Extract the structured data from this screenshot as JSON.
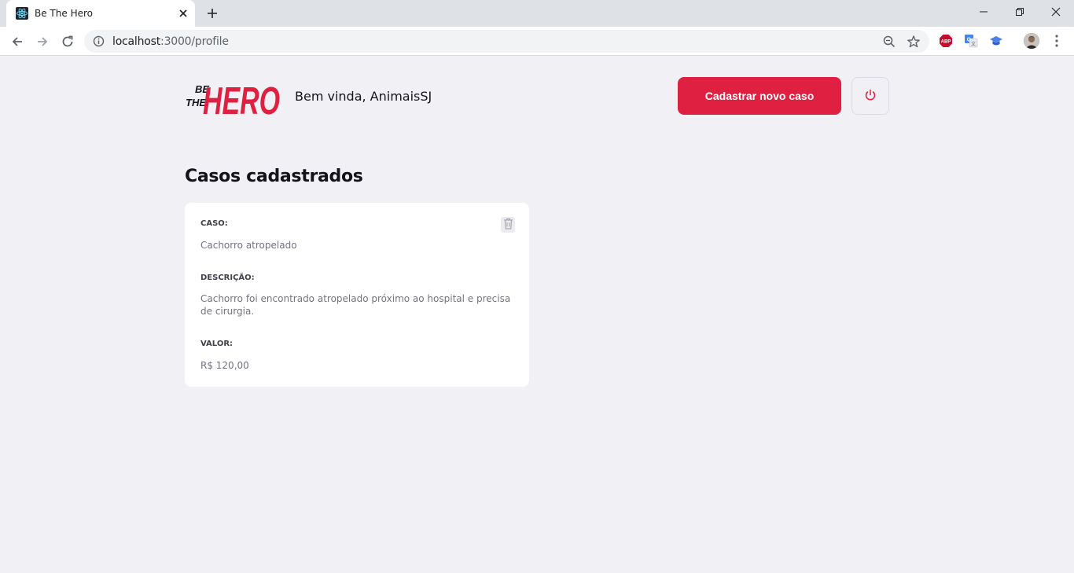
{
  "browser": {
    "tab_title": "Be The Hero",
    "url_host": "localhost",
    "url_path": ":3000/profile",
    "icons": [
      "react-favicon-icon",
      "close-icon",
      "plus-icon",
      "back-icon",
      "forward-icon",
      "reload-icon",
      "info-icon",
      "zoom-icon",
      "star-icon",
      "adblock-icon",
      "translate-icon",
      "graduation-cap-icon",
      "avatar",
      "menu-icon"
    ]
  },
  "header": {
    "logo_small_top": "BE",
    "logo_small_bottom": "THE",
    "logo_big": "HERO",
    "greeting": "Bem vinda, AnimaisSJ",
    "new_case_button": "Cadastrar novo caso",
    "logout_icon": "power-icon"
  },
  "main": {
    "title": "Casos cadastrados",
    "cases": [
      {
        "case_label": "CASO:",
        "case_value": "Cachorro atropelado",
        "description_label": "DESCRIÇÃO:",
        "description_value": "Cachorro foi encontrado atropelado próximo ao hospital e precisa de cirurgia.",
        "value_label": "VALOR:",
        "value_value": "R$ 120,00",
        "delete_icon": "trash-icon"
      }
    ]
  },
  "colors": {
    "brand_red": "#e02041",
    "background": "#f0f0f5",
    "text_dark": "#13131a",
    "text_label": "#41414d",
    "text_value": "#737380"
  }
}
